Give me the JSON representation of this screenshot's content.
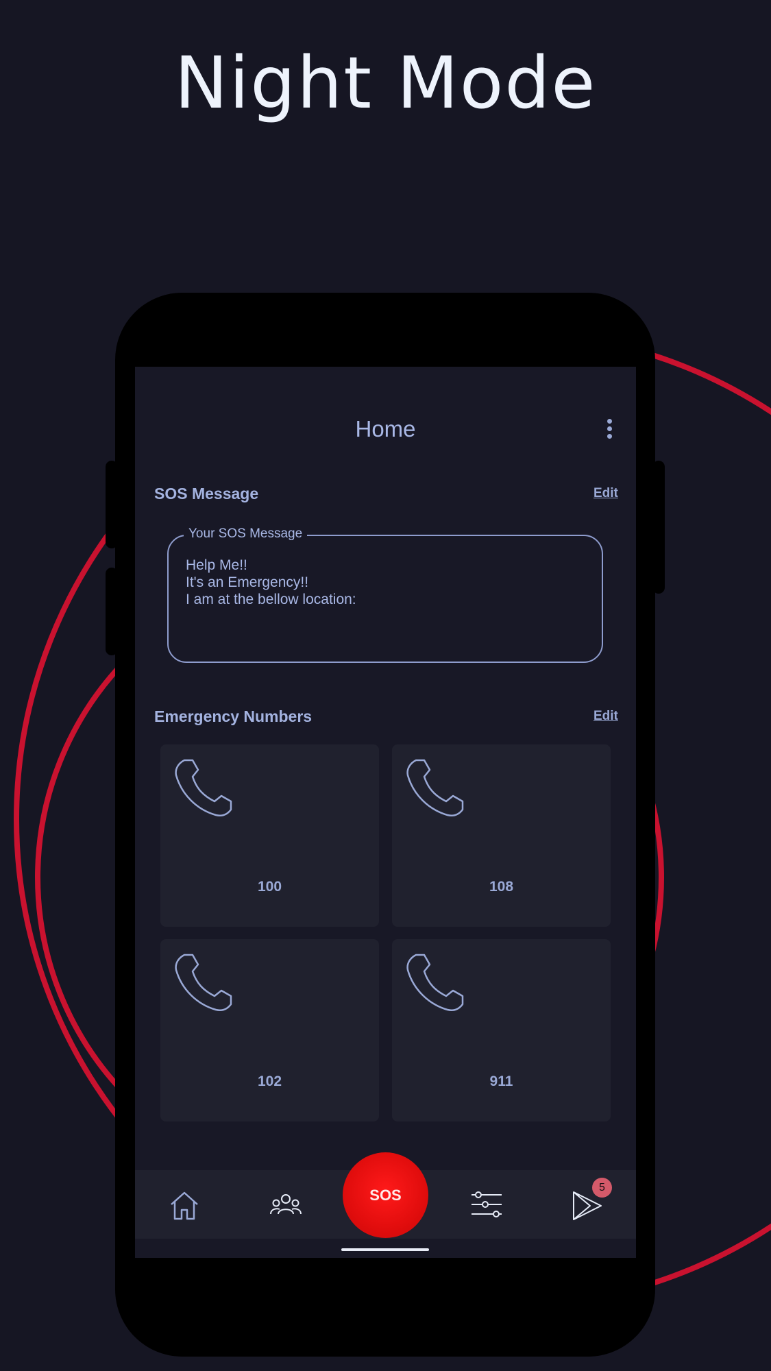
{
  "headline": "Night Mode",
  "colors": {
    "background": "#161623",
    "accent_ring": "#c9122f",
    "text_primary": "#a9b8e6",
    "card_bg": "#20212e",
    "sos_red": "#e10d0d"
  },
  "app": {
    "title": "Home",
    "menu_icon": "kebab-menu-icon"
  },
  "sos_section": {
    "title": "SOS Message",
    "edit_label": "Edit",
    "field_label": "Your SOS Message",
    "message": "Help Me!!\nIt's an Emergency!!\nI am at the bellow location:"
  },
  "emergency_section": {
    "title": "Emergency Numbers",
    "edit_label": "Edit",
    "numbers": [
      {
        "number": "100",
        "icon": "phone-icon"
      },
      {
        "number": "108",
        "icon": "phone-icon"
      },
      {
        "number": "102",
        "icon": "phone-icon"
      },
      {
        "number": "911",
        "icon": "phone-icon"
      }
    ]
  },
  "bottom_nav": {
    "items": [
      {
        "icon": "home-icon"
      },
      {
        "icon": "contacts-group-icon"
      },
      {
        "icon": "sos-button",
        "label": "SOS"
      },
      {
        "icon": "settings-sliders-icon"
      },
      {
        "icon": "play-store-icon",
        "badge": "5"
      }
    ]
  }
}
